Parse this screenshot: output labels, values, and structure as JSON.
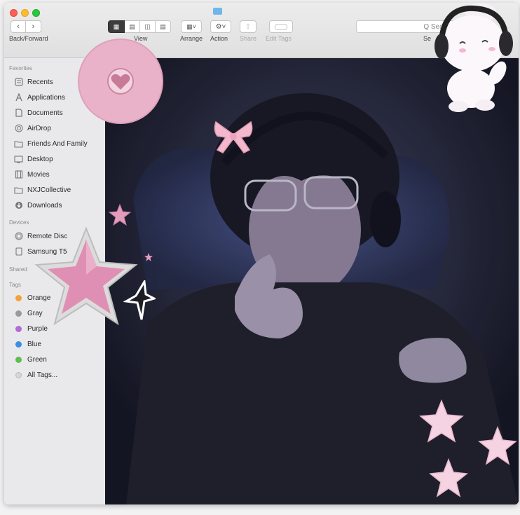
{
  "toolbar": {
    "back_forward_label": "Back/Forward",
    "view_label": "View",
    "arrange_label": "Arrange",
    "action_label": "Action",
    "share_label": "Share",
    "edit_tags_label": "Edit Tags",
    "search_placeholder": "Q Searc",
    "search_label": "Se"
  },
  "sidebar": {
    "favorites_header": "Favorites",
    "favorites": [
      {
        "label": "Recents",
        "icon": "recents-icon"
      },
      {
        "label": "Applications",
        "icon": "applications-icon"
      },
      {
        "label": "Documents",
        "icon": "documents-icon"
      },
      {
        "label": "AirDrop",
        "icon": "airdrop-icon"
      },
      {
        "label": "Friends And Family",
        "icon": "folder-icon"
      },
      {
        "label": "Desktop",
        "icon": "desktop-icon"
      },
      {
        "label": "Movies",
        "icon": "movies-icon"
      },
      {
        "label": "NXJCollective",
        "icon": "folder-icon"
      },
      {
        "label": "Downloads",
        "icon": "downloads-icon"
      }
    ],
    "devices_header": "Devices",
    "devices": [
      {
        "label": "Remote Disc",
        "icon": "disc-icon"
      },
      {
        "label": "Samsung T5",
        "icon": "drive-icon"
      }
    ],
    "shared_header": "Shared",
    "tags_header": "Tags",
    "tags": [
      {
        "label": "Orange",
        "color": "#f5a03a"
      },
      {
        "label": "Gray",
        "color": "#9a9a9a"
      },
      {
        "label": "Purple",
        "color": "#b36ad6"
      },
      {
        "label": "Blue",
        "color": "#3b8fe0"
      },
      {
        "label": "Green",
        "color": "#5cc04c"
      },
      {
        "label": "All Tags...",
        "color": "#d0d0d0"
      }
    ]
  },
  "colors": {
    "sticker_pink": "#e7a0bf",
    "star_pink": "#f2c6d8",
    "ribbon_pink": "#f4b8cd"
  }
}
